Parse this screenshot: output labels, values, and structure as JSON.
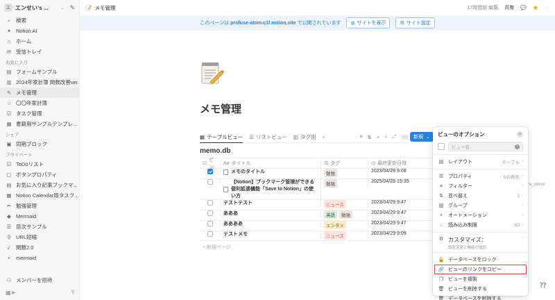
{
  "sidebar": {
    "workspace": "エンせいʼs ...",
    "nav": [
      {
        "icon": "search-icon",
        "glyph": "⌕",
        "label": "検索"
      },
      {
        "icon": "notion-ai-icon",
        "glyph": "✦",
        "label": "Notion AI"
      },
      {
        "icon": "home-icon",
        "glyph": "⌂",
        "label": "ホーム"
      },
      {
        "icon": "inbox-icon",
        "glyph": "✉",
        "label": "受信トレイ"
      }
    ],
    "favorites_label": "お気に入り",
    "favorites": [
      {
        "icon": "form-icon",
        "glyph": "▤",
        "label": "フォームサンプル"
      },
      {
        "icon": "budget-icon",
        "glyph": "▥",
        "label": "2024年家計簿 関数改善ver."
      },
      {
        "icon": "memo-icon",
        "glyph": "✎",
        "label": "メモ管理"
      },
      {
        "icon": "plan-icon",
        "glyph": "○",
        "label": "〇〇年家計簿"
      },
      {
        "icon": "task-icon",
        "glyph": "☑",
        "label": "タスク管理"
      },
      {
        "icon": "books-icon",
        "glyph": "▦",
        "label": "書籍用サンプルテンプレ..."
      }
    ],
    "shared_label": "シェア",
    "shared": [
      {
        "icon": "sync-block-icon",
        "glyph": "▣",
        "label": "同期ブロック"
      }
    ],
    "private_label": "プライベート",
    "private": [
      {
        "icon": "todo-icon",
        "glyph": "☑",
        "label": "ToDoリスト"
      },
      {
        "icon": "button-icon",
        "glyph": "▢",
        "label": "ボタンプロパティ"
      },
      {
        "icon": "bookmark-icon",
        "glyph": "▤",
        "label": "お気に入り記事ブックマ..."
      },
      {
        "icon": "calendar-icon",
        "glyph": "▦",
        "label": "Notion Calendar用タスク..."
      },
      {
        "icon": "study-icon",
        "glyph": "✏",
        "label": "勉強管理"
      },
      {
        "icon": "mermaid-icon",
        "glyph": "◆",
        "label": "Mermaid"
      },
      {
        "icon": "toc-icon",
        "glyph": "☰",
        "label": "目次サンプル"
      },
      {
        "icon": "url-icon",
        "glyph": "⚲",
        "label": "URL短縮"
      },
      {
        "icon": "func-icon",
        "glyph": "✓",
        "label": "関数2.0"
      },
      {
        "icon": "mermaid2-icon",
        "glyph": "•",
        "label": "mermaid"
      }
    ],
    "invite": "メンバーを招待"
  },
  "topbar": {
    "page": "メモ管理",
    "edited": "17時間前 編集",
    "share": "共有"
  },
  "banner": {
    "text_pre": "このページは",
    "site": "profuse-atom-c1f.notion.site",
    "text_post": "で公開されています",
    "view_site": "サイトを表示",
    "site_settings": "サイト設定"
  },
  "page": {
    "title": "メモ管理",
    "db_title": "memo.db",
    "views": [
      "テーブルビュー",
      "リストビュー",
      "タグ別"
    ],
    "new_button": "新規",
    "headers": {
      "pin": "ピン",
      "title": "タイトル",
      "tag": "タグ",
      "date": "最終更新日時"
    },
    "rows": [
      {
        "checked": true,
        "title": "メモのタイトル",
        "tags": [
          {
            "label": "勉強",
            "bg": "#e9e5e3",
            "fg": "#64473a"
          }
        ],
        "date": "2023/04/29 9:08"
      },
      {
        "checked": false,
        "title": "【Notion】ブックマーク管理ができる便利拡張機能「Save to Notion」の使い方",
        "tags": [
          {
            "label": "勉強",
            "bg": "#e9e5e3",
            "fg": "#64473a"
          }
        ],
        "date": "2025/04/29 15:35",
        "doc": true
      },
      {
        "checked": false,
        "title": "テストテスト",
        "tags": [
          {
            "label": "ニュース",
            "bg": "#ffe2dd",
            "fg": "#c4554d"
          }
        ],
        "date": "2023/04/29 9:47"
      },
      {
        "checked": false,
        "title": "あああ",
        "tags": [
          {
            "label": "英語",
            "bg": "#dbeddb",
            "fg": "#2b593f"
          },
          {
            "label": "勉強",
            "bg": "#e9e5e3",
            "fg": "#64473a"
          }
        ],
        "date": "2023/04/29 9:47"
      },
      {
        "checked": false,
        "title": "ああああ",
        "tags": [
          {
            "label": "エンタメ",
            "bg": "#fdecc8",
            "fg": "#89632a"
          }
        ],
        "date": "2023/04/29 9:47"
      },
      {
        "checked": false,
        "title": "テストメモ",
        "tags": [
          {
            "label": "ニュース",
            "bg": "#ffe2dd",
            "fg": "#c4554d"
          }
        ],
        "date": "2023/04/29 9:09"
      }
    ],
    "new_page": "新規ページ",
    "overflow_url": "v_otion/"
  },
  "options": {
    "title": "ビューのオプション",
    "name_placeholder": "ビュー名",
    "items_a": [
      {
        "icon": "layout-icon",
        "glyph": "▤",
        "label": "レイアウト",
        "value": "テーブル"
      }
    ],
    "items_b": [
      {
        "icon": "properties-icon",
        "glyph": "☰",
        "label": "プロパティ",
        "value": "6の表示"
      },
      {
        "icon": "filter-icon",
        "glyph": "≡",
        "label": "フィルター",
        "value": ""
      },
      {
        "icon": "sort-icon",
        "glyph": "⇅",
        "label": "並べ替え",
        "value": "3"
      },
      {
        "icon": "group-icon",
        "glyph": "▥",
        "label": "グループ",
        "value": ""
      },
      {
        "icon": "automation-icon",
        "glyph": "⚡",
        "label": "オートメーション",
        "value": ""
      },
      {
        "icon": "load-limit-icon",
        "glyph": "↓",
        "label": "読み込み制限",
        "value": "50"
      }
    ],
    "customize": {
      "label": "カスタマイズ：",
      "sub": "設定変更と機能の追加"
    },
    "items_c": [
      {
        "icon": "lock-icon",
        "glyph": "🔒",
        "label": "データベースをロック",
        "hl": false
      },
      {
        "icon": "link-icon",
        "glyph": "🔗",
        "label": "ビューのリンクをコピー",
        "hl": true
      },
      {
        "icon": "duplicate-icon",
        "glyph": "❐",
        "label": "ビューを複製",
        "hl": false
      },
      {
        "icon": "trash-icon",
        "glyph": "🗑",
        "label": "ビューを削除する",
        "hl": false
      },
      {
        "icon": "trash-db-icon",
        "glyph": "🗑",
        "label": "データベースを削除する",
        "hl": false
      }
    ]
  }
}
